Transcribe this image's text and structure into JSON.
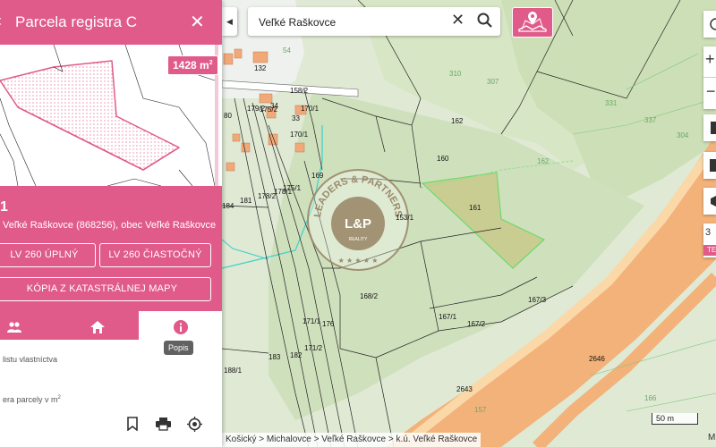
{
  "panel": {
    "back_icon": "‹",
    "title": "Parcela registra C",
    "close_icon": "✕",
    "area_badge_value": "1428 m",
    "area_badge_sup": "2",
    "parcel_number": "1",
    "location_text": "Veľké Raškovce (868256), obec Veľké Raškovce",
    "buttons": {
      "lv_full": "LV 260 ÚPLNÝ",
      "lv_partial": "LV 260 ČIASTOČNÝ",
      "copy_map": "KÓPIA Z KATASTRÁLNEJ MAPY"
    },
    "tooltip": "Popis",
    "text_line1": "listu vlastníctva",
    "text_line2": "era parcely v m",
    "text_line2_sup": "2"
  },
  "search": {
    "value": "Veľké Raškovce",
    "placeholder": ""
  },
  "breadcrumb": "Košický > Michalovce > Veľké Raškovce > k.ú. Veľké Raškovce",
  "scale_label": "50 m",
  "corner_label": "M",
  "right_tools": {
    "side_badge": "3",
    "side_badge2": "TE"
  },
  "watermark": {
    "top_text": "LEADERS & PARTNERS",
    "logo_text": "L&P",
    "sub_text": "REALITY"
  },
  "map_labels": [
    {
      "t": "54"
    },
    {
      "t": "132"
    },
    {
      "t": "310"
    },
    {
      "t": "307"
    },
    {
      "t": "158/2"
    },
    {
      "t": "179/2"
    },
    {
      "t": "175/2"
    },
    {
      "t": "34"
    },
    {
      "t": "170/1"
    },
    {
      "t": "33"
    },
    {
      "t": "170/1"
    },
    {
      "t": "162"
    },
    {
      "t": "160"
    },
    {
      "t": "162"
    },
    {
      "t": "181"
    },
    {
      "t": "178/2"
    },
    {
      "t": "175/1"
    },
    {
      "t": "169"
    },
    {
      "t": "153/1"
    },
    {
      "t": "161"
    },
    {
      "t": "184"
    },
    {
      "t": "168/2"
    },
    {
      "t": "167/3"
    },
    {
      "t": "167/1"
    },
    {
      "t": "167/2"
    },
    {
      "t": "176"
    },
    {
      "t": "183"
    },
    {
      "t": "182"
    },
    {
      "t": "188/1"
    },
    {
      "t": "2646"
    },
    {
      "t": "2643"
    },
    {
      "t": "166"
    },
    {
      "t": "157"
    },
    {
      "t": "337"
    },
    {
      "t": "331"
    },
    {
      "t": "304"
    },
    {
      "t": "171/1"
    },
    {
      "t": "171/2"
    },
    {
      "t": "178/1"
    },
    {
      "t": "80"
    }
  ],
  "colors": {
    "accent": "#e05a8a",
    "map_bg": "#e8efe4",
    "highway": "#f2b279",
    "parcel_highlight": "#c9c98a"
  },
  "icons": {
    "search": "search-icon",
    "clear": "close-icon",
    "owners": "people-icon",
    "home": "home-icon",
    "info": "info-icon",
    "bookmark": "bookmark-icon",
    "print": "printer-icon",
    "locate": "target-icon"
  }
}
